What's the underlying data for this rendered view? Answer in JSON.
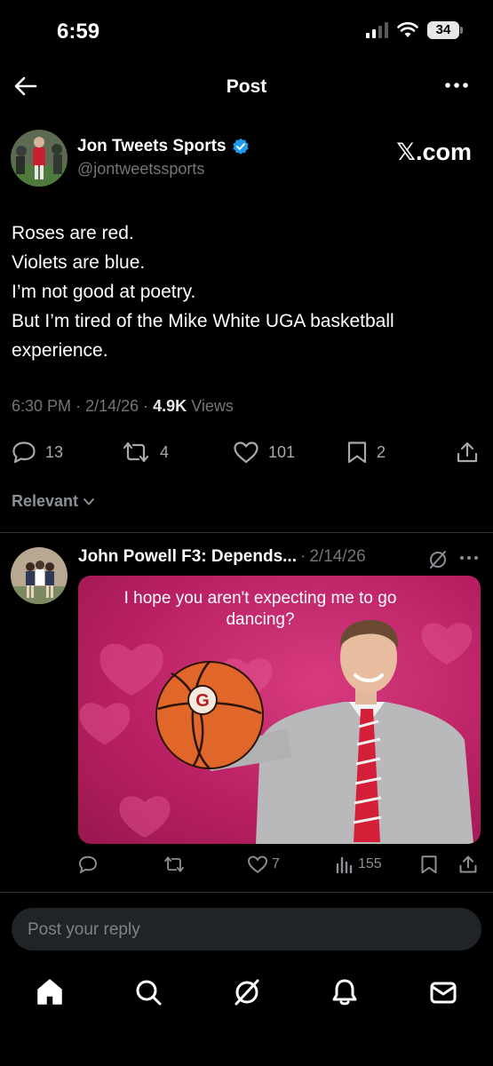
{
  "status_bar": {
    "time": "6:59",
    "battery": "34"
  },
  "header": {
    "title": "Post",
    "back_icon": "arrow-left-icon",
    "more_icon": "ellipsis-icon"
  },
  "author": {
    "name": "Jon Tweets Sports",
    "handle": "@jontweetssports",
    "verified": true,
    "watermark": "𝕏.com"
  },
  "tweet": {
    "lines": [
      "Roses are red.",
      "Violets are blue.",
      "I’m not good at poetry.",
      "But I’m tired of the Mike White UGA basketball experience."
    ],
    "time": "6:30 PM",
    "date": "2/14/26",
    "views_count": "4.9K",
    "views_label": "Views",
    "replies": "13",
    "reposts": "4",
    "likes": "101",
    "bookmarks": "2"
  },
  "sort": {
    "label": "Relevant"
  },
  "reply": {
    "name": "John Powell F3: Depends...",
    "sep": "·",
    "date": "2/14/26",
    "image_caption": "I hope you aren't expecting me to go dancing?",
    "replies": "",
    "reposts": "",
    "likes": "7",
    "views": "155"
  },
  "composer": {
    "placeholder": "Post your reply"
  },
  "tabs": [
    "home-icon",
    "search-icon",
    "grok-icon",
    "notifications-icon",
    "messages-icon"
  ],
  "colors": {
    "background": "#000000",
    "text": "#e7e9ea",
    "muted": "#71767b",
    "verified": "#1d9bf0",
    "meme_pink": "#c8246b"
  }
}
